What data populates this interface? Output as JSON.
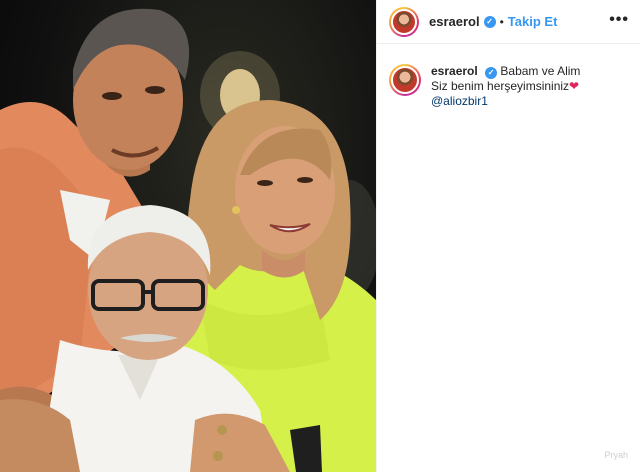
{
  "post": {
    "username": "esraerol",
    "verified_icon": "verified-badge-icon",
    "separator": "•",
    "follow_label": "Takip Et",
    "more_label": "•••",
    "caption": {
      "line1": "Babam ve Alim",
      "line2": "Siz benim herşeyimsininiz",
      "heart": "❤",
      "mention": "@aliozbir1"
    },
    "watermark": "Pryah"
  },
  "colors": {
    "accent": "#3897f0",
    "heart": "#e0245e",
    "mention": "#00376b",
    "border": "#efefef"
  },
  "photo": {
    "description_icon": "family-photo"
  }
}
